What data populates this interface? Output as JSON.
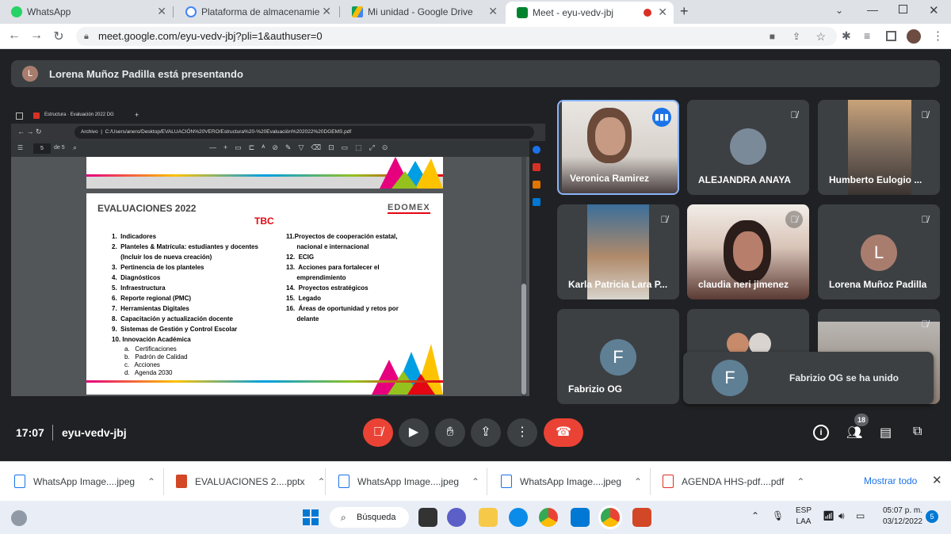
{
  "browser": {
    "tabs": [
      {
        "title": "WhatsApp"
      },
      {
        "title": "Plataforma de almacenamiento p"
      },
      {
        "title": "Mi unidad - Google Drive"
      },
      {
        "title": "Meet - eyu-vedv-jbj"
      }
    ],
    "url": "meet.google.com/eyu-vedv-jbj?pli=1&authuser=0"
  },
  "meet": {
    "presenter_initial": "L",
    "presenter_text": "Lorena Muñoz Padilla está presentando",
    "time": "17:07",
    "meeting_code": "eyu-vedv-jbj",
    "participant_count": "18",
    "join_toast": {
      "initial": "F",
      "text": "Fabrizio OG se ha unido"
    },
    "participants": [
      {
        "name": "Veronica Ramirez"
      },
      {
        "name": "ALEJANDRA ANAYA"
      },
      {
        "name": "Humberto Eulogio ..."
      },
      {
        "name": "Karla Patricia Lara P..."
      },
      {
        "name": "claudia neri jimenez"
      },
      {
        "name": "Lorena Muñoz Padilla",
        "initial": "L"
      },
      {
        "name": "Fabrizio OG",
        "initial": "F"
      }
    ],
    "colors": {
      "end_call": "#ea4335",
      "mic_off": "#ea4335",
      "avatar_l": "#a97d6e",
      "avatar_f": "#5f7f95",
      "speaking": "#8ab4f8"
    }
  },
  "shared_screen": {
    "tabs": [
      "Estructura",
      "Evaluación 2022 DG"
    ],
    "address": "C:/Users/anero/Desktop/EVALUACIÓN%20VERO/Estructura%20-%20Evaluación%202022%20DGEMS.pdf",
    "address_label": "Archivo",
    "page": "5",
    "page_total": "de 5",
    "slide": {
      "title": "EVALUACIONES 2022",
      "subtitle": "TBC",
      "logo": "EDOMEX",
      "left_items": [
        "1.  Indicadores",
        "2.  Planteles & Matrícula: estudiantes y docentes",
        "     (Incluir los de nueva creación)",
        "3.  Pertinencia de los planteles",
        "4.  Diagnósticos",
        "5.  Infraestructura",
        "6.  Reporte regional (PMC)",
        "7.  Herramientas Digitales",
        "8.  Capacitación y actualización docente",
        "9.  Sistemas de Gestión y Control Escolar",
        "10. Innovación Académica"
      ],
      "sub_items": [
        "a.   Certificaciones",
        "b.   Padrón de Calidad",
        "c.   Acciones",
        "d.   Agenda 2030"
      ],
      "right_items": [
        "11.Proyectos de cooperación estatal,",
        "      nacional e internacional",
        "12.  ECIG",
        "13.  Acciones para fortalecer el",
        "      emprendimiento",
        "14.  Proyectos estratégicos",
        "15.  Legado",
        "16.  Áreas de oportunidad y retos por",
        "      delante"
      ]
    }
  },
  "downloads": {
    "items": [
      {
        "name": "WhatsApp Image....jpeg"
      },
      {
        "name": "EVALUACIONES 2....pptx"
      },
      {
        "name": "WhatsApp Image....jpeg"
      },
      {
        "name": "WhatsApp Image....jpeg"
      },
      {
        "name": "AGENDA HHS-pdf....pdf"
      }
    ],
    "show_all": "Mostrar todo"
  },
  "taskbar": {
    "search": "Búsqueda",
    "lang": "ESP",
    "lang2": "LAA",
    "time": "05:07 p. m.",
    "date": "03/12/2022",
    "notif": "5"
  }
}
